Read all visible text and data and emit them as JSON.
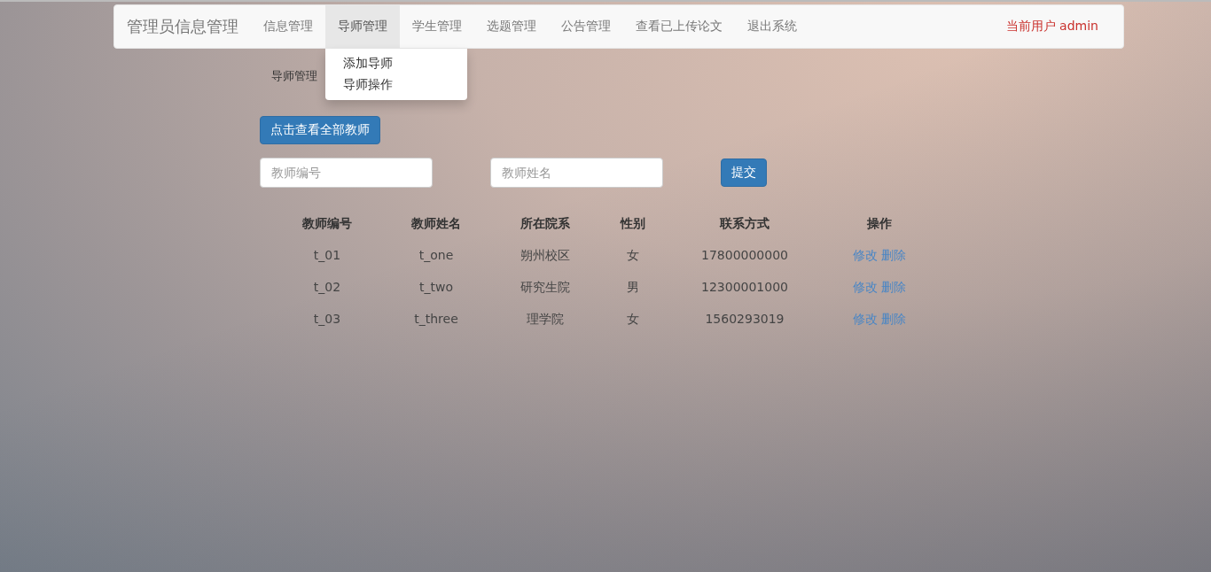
{
  "navbar": {
    "brand": "管理员信息管理",
    "items": [
      {
        "label": "信息管理",
        "selected": false
      },
      {
        "label": "导师管理",
        "selected": true,
        "dropdown": [
          "添加导师",
          "导师操作"
        ]
      },
      {
        "label": "学生管理",
        "selected": false
      },
      {
        "label": "选题管理",
        "selected": false
      },
      {
        "label": "公告管理",
        "selected": false
      },
      {
        "label": "查看已上传论文",
        "selected": false
      },
      {
        "label": "退出系统",
        "selected": false
      }
    ],
    "current_user": "当前用户 admin"
  },
  "section_label": "导师管理",
  "view_all_button": "点击查看全部教师",
  "search": {
    "fields": [
      {
        "placeholder": "教师编号"
      },
      {
        "placeholder": "教师姓名"
      }
    ],
    "submit": "提交"
  },
  "table": {
    "columns": [
      "教师编号",
      "教师姓名",
      "所在院系",
      "性别",
      "联系方式",
      "操作"
    ],
    "rows": [
      {
        "cells": [
          "t_01",
          "t_one",
          "朔州校区",
          "女",
          "17800000000"
        ],
        "actions": [
          "修改",
          "删除"
        ]
      },
      {
        "cells": [
          "t_02",
          "t_two",
          "研究生院",
          "男",
          "12300001000"
        ],
        "actions": [
          "修改",
          "删除"
        ]
      },
      {
        "cells": [
          "t_03",
          "t_three",
          "理学院",
          "女",
          "1560293019"
        ],
        "actions": [
          "修改",
          "删除"
        ]
      }
    ]
  }
}
